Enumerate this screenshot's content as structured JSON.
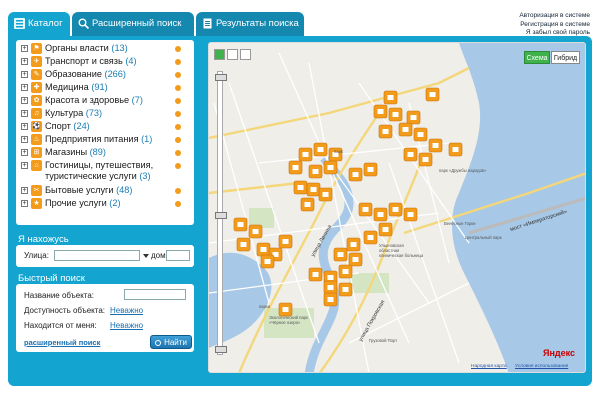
{
  "tabs": [
    {
      "label": "Каталог",
      "icon": "list-icon"
    },
    {
      "label": "Расширенный поиск",
      "icon": "search-settings-icon"
    },
    {
      "label": "Результаты поиска",
      "icon": "document-icon"
    }
  ],
  "auth": {
    "login": "Авторизация в системе",
    "register": "Регистрация в системе",
    "forgot": "Я забыл свой пароль"
  },
  "catalog": {
    "items": [
      {
        "label": "Органы власти",
        "count": "(13)"
      },
      {
        "label": "Транспорт и связь",
        "count": "(4)"
      },
      {
        "label": "Образование",
        "count": "(266)"
      },
      {
        "label": "Медицина",
        "count": "(91)"
      },
      {
        "label": "Красота и здоровье",
        "count": "(7)"
      },
      {
        "label": "Культура",
        "count": "(73)"
      },
      {
        "label": "Спорт",
        "count": "(24)"
      },
      {
        "label": "Предприятия питания",
        "count": "(1)"
      },
      {
        "label": "Магазины",
        "count": "(89)"
      },
      {
        "label": "Гостиницы, путешествия, туристические услуги",
        "count": "(3)"
      },
      {
        "label": "Бытовые услуги",
        "count": "(48)"
      },
      {
        "label": "Прочие услуги",
        "count": "(2)"
      }
    ]
  },
  "location": {
    "title": "Я нахожусь",
    "street_label": "Улица:",
    "house_label": "дом №",
    "street_value": "",
    "house_value": ""
  },
  "quick_search": {
    "title": "Быстрый поиск",
    "name_label": "Название объекта:",
    "name_value": "",
    "availability_label": "Доступность объекта:",
    "availability_value": "Неважно",
    "distance_label": "Находится от меня:",
    "distance_value": "Неважно",
    "advanced_link": "расширенный поиск",
    "find_button": "Найти"
  },
  "map": {
    "scheme_button": "Схема",
    "hybrid_button": "Гибрид",
    "brand": "Яндекс",
    "footer_left": "Народная карта",
    "footer_right": "Условия использования",
    "labels": {
      "bridge": "мост «Императорский»",
      "lenin": "улица Ленина",
      "pokrovskaya": "улица Покровская",
      "gorki": "Венесные Горки",
      "hospital": "Ульяновская областная клиническая больница",
      "port": "Грузовой Порт",
      "park1": "парк «Дружбы народов»",
      "park2": "парк",
      "park3": "парки",
      "ecopark": "Экологический парк «Чёрное озеро»",
      "central": "Центральный парк"
    }
  },
  "colors": {
    "brand_blue": "#13a4cf",
    "marker_orange": "#f39b1b",
    "water": "#a7c8e6"
  }
}
